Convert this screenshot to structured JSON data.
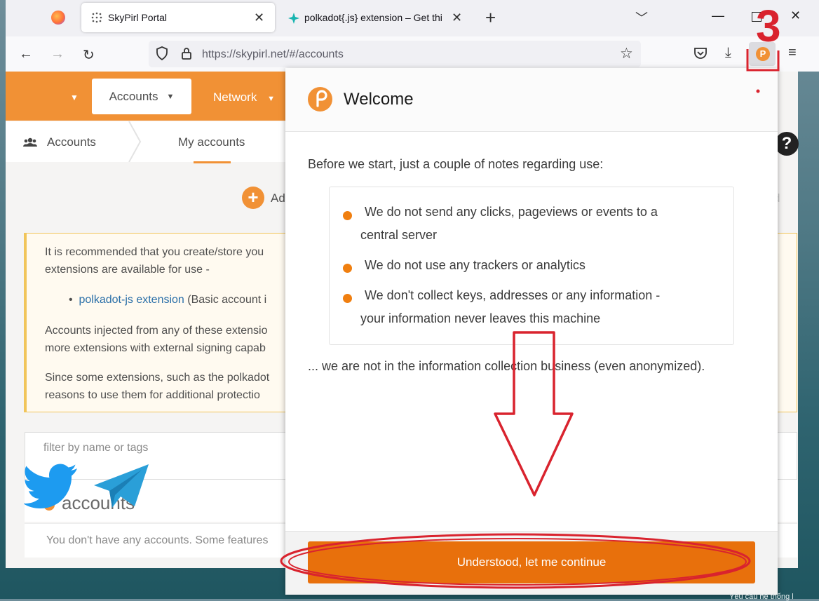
{
  "browser": {
    "tabs": [
      {
        "label": "SkyPirl Portal"
      },
      {
        "label": "polkadot{.js} extension – Get thi"
      }
    ],
    "url": "https://skypirl.net/#/accounts"
  },
  "page": {
    "nav": {
      "accounts": "Accounts",
      "network": "Network"
    },
    "subnav": {
      "crumb1": "Accounts",
      "crumb2": "My accounts"
    },
    "add_label": "Ad",
    "info": {
      "p1_line1": "It is recommended that you create/store you",
      "p1_line2": "extensions are available for use -",
      "link": "polkadot-js extension",
      "link_rest": " (Basic account i",
      "p2_line1": "Accounts injected from any of these extensio",
      "p2_line2": "more extensions with external signing capab",
      "p3_line1": "Since some extensions, such as the polkadot",
      "p3_line2": "reasons to use them for additional protectio"
    },
    "filter_placeholder": "filter by name or tags",
    "accounts_heading": "accounts",
    "no_accounts": "You don't have any accounts. Some features"
  },
  "popup": {
    "title": "Welcome",
    "intro": "Before we start, just a couple of notes regarding use:",
    "notes": [
      {
        "line1": "We do not send any clicks, pageviews or events to a",
        "line2": "central server"
      },
      {
        "line1": "We do not use any trackers or analytics",
        "line2": ""
      },
      {
        "line1": "We don't collect keys, addresses or any information -",
        "line2": "your information never leaves this machine"
      }
    ],
    "outro": "... we are not in the information collection business (even anonymized).",
    "button": "Understood, let me continue"
  },
  "annotation": {
    "step_number": "3",
    "color": "#d9232e"
  },
  "colors": {
    "accent": "#f19135",
    "button": "#e8700c",
    "link": "#2a6fa8"
  },
  "overlay": {
    "bottom_text": "Yêu cầu hệ thống l"
  }
}
